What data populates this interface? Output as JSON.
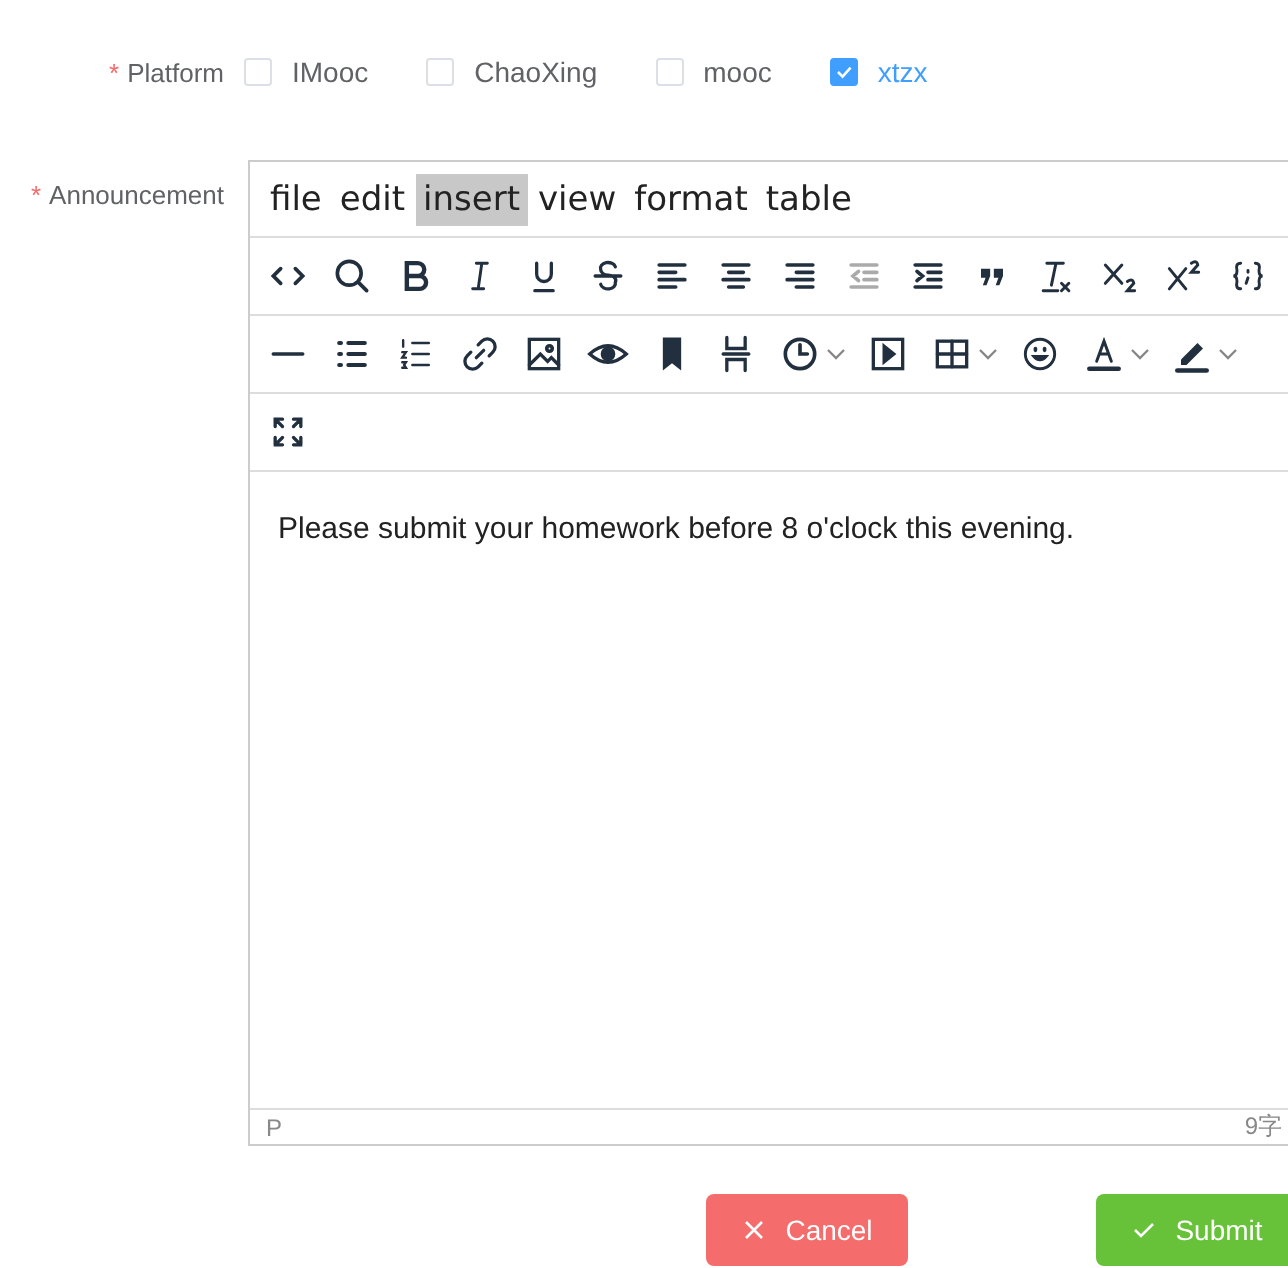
{
  "platform": {
    "label": "Platform",
    "required_mark": "*",
    "options": [
      {
        "label": "IMooc",
        "checked": false
      },
      {
        "label": "ChaoXing",
        "checked": false
      },
      {
        "label": "mooc",
        "checked": false
      },
      {
        "label": "xtzx",
        "checked": true
      }
    ]
  },
  "announcement": {
    "label": "Announcement",
    "required_mark": "*",
    "menu": [
      {
        "label": "file",
        "selected": false
      },
      {
        "label": "edit",
        "selected": false
      },
      {
        "label": "insert",
        "selected": true
      },
      {
        "label": "view",
        "selected": false
      },
      {
        "label": "format",
        "selected": false
      },
      {
        "label": "table",
        "selected": false
      }
    ],
    "toolbar_rows": [
      [
        {
          "kind": "code",
          "disabled": false
        },
        {
          "kind": "search",
          "disabled": false
        },
        {
          "kind": "bold",
          "disabled": false
        },
        {
          "kind": "italic",
          "disabled": false
        },
        {
          "kind": "underline",
          "disabled": false
        },
        {
          "kind": "strike",
          "disabled": false
        },
        {
          "kind": "align-left",
          "disabled": false
        },
        {
          "kind": "align-center",
          "disabled": false
        },
        {
          "kind": "align-right",
          "disabled": false
        },
        {
          "kind": "outdent",
          "disabled": true
        },
        {
          "kind": "indent",
          "disabled": false
        },
        {
          "kind": "quote",
          "disabled": false
        },
        {
          "kind": "clear-format",
          "disabled": false
        },
        {
          "kind": "subscript",
          "disabled": false
        },
        {
          "kind": "superscript",
          "disabled": false
        },
        {
          "kind": "code-sample",
          "disabled": false
        }
      ],
      [
        {
          "kind": "hr",
          "disabled": false
        },
        {
          "kind": "bullet-list",
          "disabled": false
        },
        {
          "kind": "number-list",
          "disabled": false
        },
        {
          "kind": "link",
          "disabled": false
        },
        {
          "kind": "image",
          "disabled": false
        },
        {
          "kind": "preview",
          "disabled": false
        },
        {
          "kind": "bookmark",
          "disabled": false
        },
        {
          "kind": "page-break",
          "disabled": false
        },
        {
          "kind": "clock",
          "disabled": false,
          "dropdown": true
        },
        {
          "kind": "media",
          "disabled": false
        },
        {
          "kind": "table",
          "disabled": false,
          "dropdown": true
        },
        {
          "kind": "emoji",
          "disabled": false
        },
        {
          "kind": "text-color",
          "disabled": false,
          "dropdown": true
        },
        {
          "kind": "highlight",
          "disabled": false,
          "dropdown": true
        }
      ],
      [
        {
          "kind": "fullscreen",
          "disabled": false
        }
      ]
    ],
    "content": "Please submit your homework before 8 o'clock this evening.",
    "status_path": "P",
    "word_count": "9字"
  },
  "buttons": [
    {
      "kind": "cancel",
      "label": "Cancel"
    },
    {
      "kind": "submit",
      "label": "Submit"
    }
  ]
}
